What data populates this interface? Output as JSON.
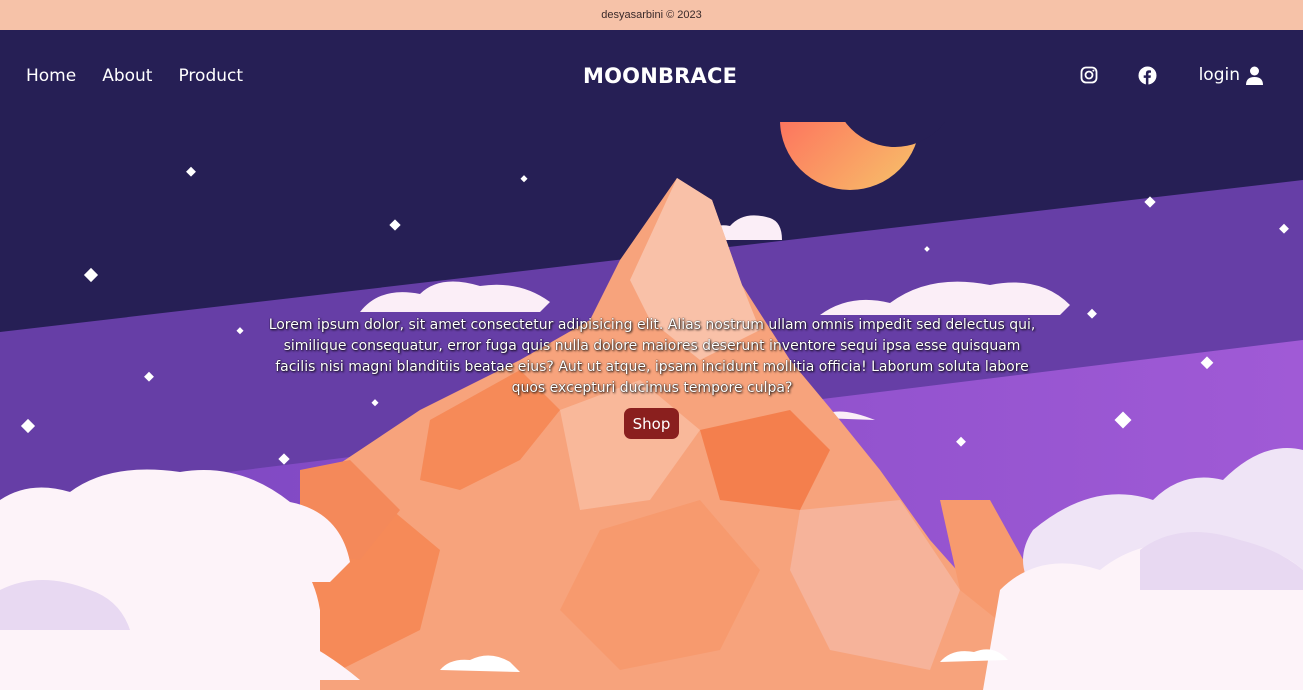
{
  "footer": {
    "copyright": "desyasarbini © 2023"
  },
  "nav": {
    "links": [
      "Home",
      "About",
      "Product"
    ],
    "brand": "MOONBRACE",
    "login_label": "login"
  },
  "hero": {
    "text": "Lorem ipsum dolor, sit amet consectetur adipisicing elit. Alias nostrum ullam omnis impedit sed delectus qui, similique consequatur, error fuga quis nulla dolore maiores deserunt inventore sequi ipsa esse quisquam facilis nisi magni blanditiis beatae eius? Aut ut atque, ipsam incidunt mollitia officia! Laborum soluta labore quos excepturi ducimus tempore culpa?",
    "shop_label": "Shop"
  },
  "colors": {
    "topbar": "#f6c2a8",
    "sky_dark": "#261f55",
    "sky_band": "#6a3fa8",
    "sky_band_light": "#9a58d0",
    "mountain": "#f79a6e",
    "cloud": "#fdf0f6",
    "shop_button": "#8a1f1e"
  }
}
